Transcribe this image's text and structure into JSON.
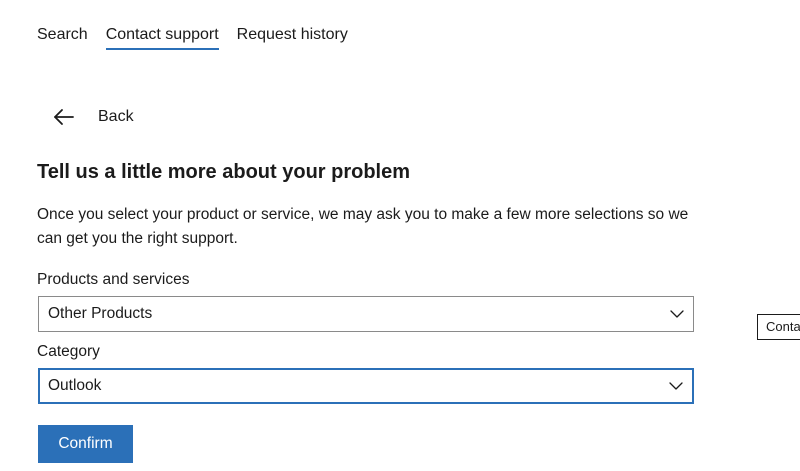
{
  "tabs": [
    {
      "label": "Search",
      "active": false
    },
    {
      "label": "Contact support",
      "active": true
    },
    {
      "label": "Request history",
      "active": false
    }
  ],
  "back": {
    "label": "Back",
    "icon": "arrow-left-icon"
  },
  "form": {
    "heading": "Tell us a little more about your problem",
    "description": "Once you select your product or service, we may ask you to make a few more selections so we can get you the right support.",
    "products": {
      "label": "Products and services",
      "value": "Other Products"
    },
    "category": {
      "label": "Category",
      "value": "Outlook"
    },
    "confirm_label": "Confirm"
  },
  "side_tooltip": {
    "label": "Conta"
  },
  "colors": {
    "accent": "#2b70b8",
    "text": "#1b1b1b",
    "border": "#8a8a8a"
  }
}
